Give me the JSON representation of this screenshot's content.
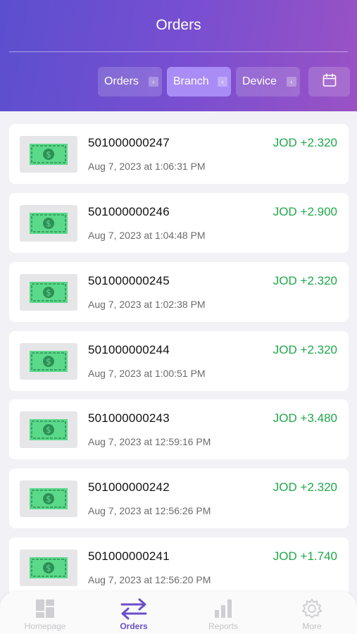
{
  "header": {
    "title": "Orders",
    "filters": [
      {
        "label": "Orders",
        "active": false
      },
      {
        "label": "Branch",
        "active": true
      },
      {
        "label": "Device",
        "active": false
      }
    ],
    "calendar_icon": "calendar-icon"
  },
  "orders": [
    {
      "id": "501000000247",
      "date": "Aug 7, 2023 at 1:06:31 PM",
      "amount": "JOD +2.320",
      "icon": "cash-icon"
    },
    {
      "id": "501000000246",
      "date": "Aug 7, 2023 at 1:04:48 PM",
      "amount": "JOD +2.900",
      "icon": "cash-icon"
    },
    {
      "id": "501000000245",
      "date": "Aug 7, 2023 at 1:02:38 PM",
      "amount": "JOD +2.320",
      "icon": "cash-icon"
    },
    {
      "id": "501000000244",
      "date": "Aug 7, 2023 at 1:00:51 PM",
      "amount": "JOD +2.320",
      "icon": "cash-icon"
    },
    {
      "id": "501000000243",
      "date": "Aug 7, 2023 at 12:59:16 PM",
      "amount": "JOD +3.480",
      "icon": "cash-icon"
    },
    {
      "id": "501000000242",
      "date": "Aug 7, 2023 at 12:56:26 PM",
      "amount": "JOD +2.320",
      "icon": "cash-icon"
    },
    {
      "id": "501000000241",
      "date": "Aug 7, 2023 at 12:56:20 PM",
      "amount": "JOD +1.740",
      "icon": "cash-icon"
    }
  ],
  "tabbar": {
    "tabs": [
      {
        "label": "Homepage",
        "icon": "homepage-icon",
        "active": false
      },
      {
        "label": "Orders",
        "icon": "orders-arrows-icon",
        "active": true
      },
      {
        "label": "Reports",
        "icon": "reports-bar-icon",
        "active": false
      },
      {
        "label": "More",
        "icon": "gear-icon",
        "active": false
      }
    ]
  },
  "colors": {
    "accent": "#6a4fc8",
    "amount_positive": "#1fa84a",
    "active_filter": "#a98cf5"
  }
}
